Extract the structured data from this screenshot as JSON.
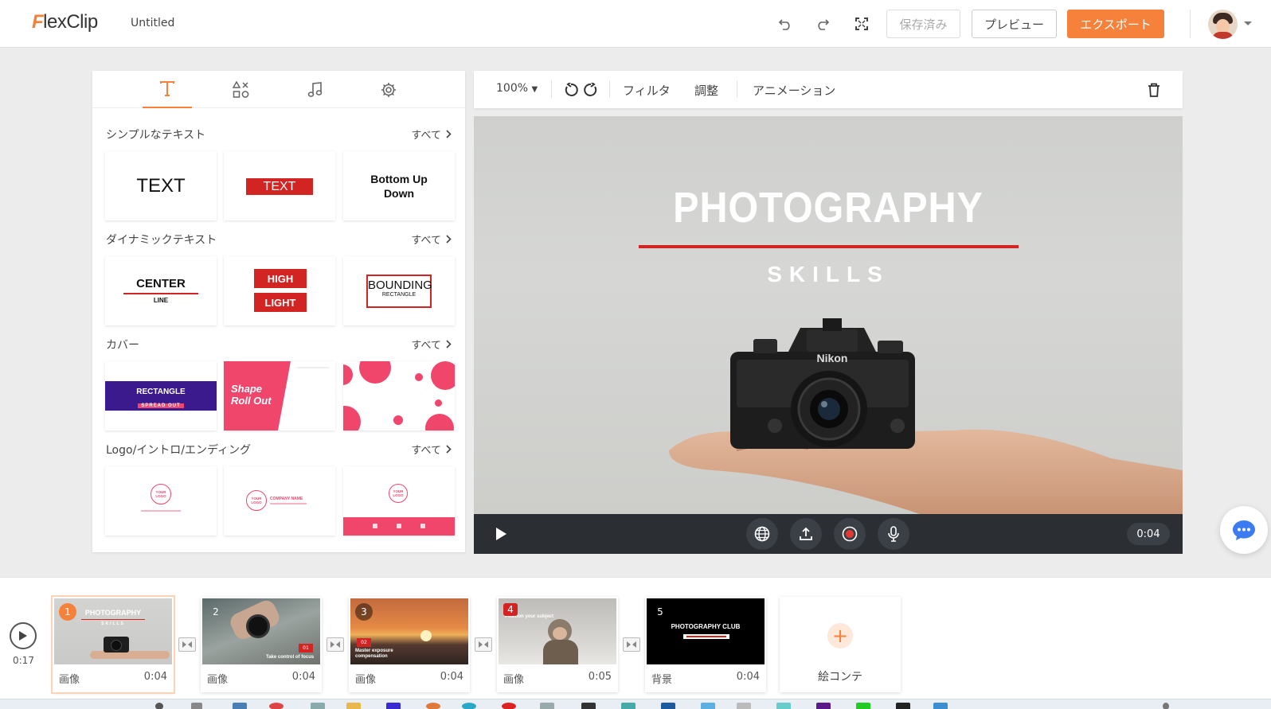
{
  "app": {
    "logo_f": "F",
    "logo_rest": "lexClip",
    "project_title": "Untitled"
  },
  "topbar": {
    "saved_label": "保存済み",
    "preview_label": "プレビュー",
    "export_label": "エクスポート",
    "icons": [
      "undo-icon",
      "redo-icon",
      "fullscreen-icon"
    ]
  },
  "left_panel": {
    "tabs": [
      "text-icon",
      "elements-icon",
      "music-icon",
      "settings-icon"
    ],
    "active_tab": 0,
    "sections": [
      {
        "title": "シンプルなテキスト",
        "all": "すべて",
        "tiles": [
          "TEXT",
          "TEXT",
          "Bottom Up\nDown"
        ]
      },
      {
        "title": "ダイナミックテキスト",
        "all": "すべて",
        "tiles": [
          [
            "CENTER",
            "LINE"
          ],
          [
            "HIGH",
            "LIGHT"
          ],
          [
            "BOUNDING",
            "RECTANGLE"
          ]
        ]
      },
      {
        "title": "カバー",
        "all": "すべて",
        "tiles": [
          [
            "RECTANGLE",
            "SPREAD OUT"
          ],
          [
            "Shape",
            "Roll Out"
          ],
          ""
        ]
      },
      {
        "title": "Logo/イントロ/エンディング",
        "all": "すべて",
        "tiles": [
          [
            "YOUR",
            "LOGO"
          ],
          [
            "YOUR",
            "LOGO",
            "COMPANY NAME"
          ],
          [
            "YOUR",
            "LOGO"
          ]
        ]
      }
    ]
  },
  "editor": {
    "zoom": "100%",
    "filter_label": "フィルタ",
    "adjust_label": "調整",
    "animation_label": "アニメーション",
    "canvas_title": "PHOTOGRAPHY",
    "canvas_subtitle": "SKILLS",
    "camera_brand": "Nikon",
    "time": "0:04"
  },
  "timeline": {
    "total": "0:17",
    "scenes": [
      {
        "num": "1",
        "type": "画像",
        "duration": "0:04",
        "caption": "PHOTOGRAPHY",
        "sub": "SKILLS"
      },
      {
        "num": "2",
        "type": "画像",
        "duration": "0:04",
        "badge": "01",
        "caption": "Take control of focus"
      },
      {
        "num": "3",
        "type": "画像",
        "duration": "0:04",
        "badge": "02",
        "caption": "Master exposure compensation"
      },
      {
        "num": "4",
        "type": "画像",
        "duration": "0:05",
        "caption": "Position your subject"
      },
      {
        "num": "5",
        "type": "背景",
        "duration": "0:04",
        "caption": "PHOTOGRAPHY CLUB"
      }
    ],
    "add_label": "絵コンテ"
  },
  "colors": {
    "accent": "#f5813b",
    "red": "#d12423",
    "pink": "#f0466c",
    "purple": "#3b1a8e",
    "chat": "#3d7bf0"
  }
}
